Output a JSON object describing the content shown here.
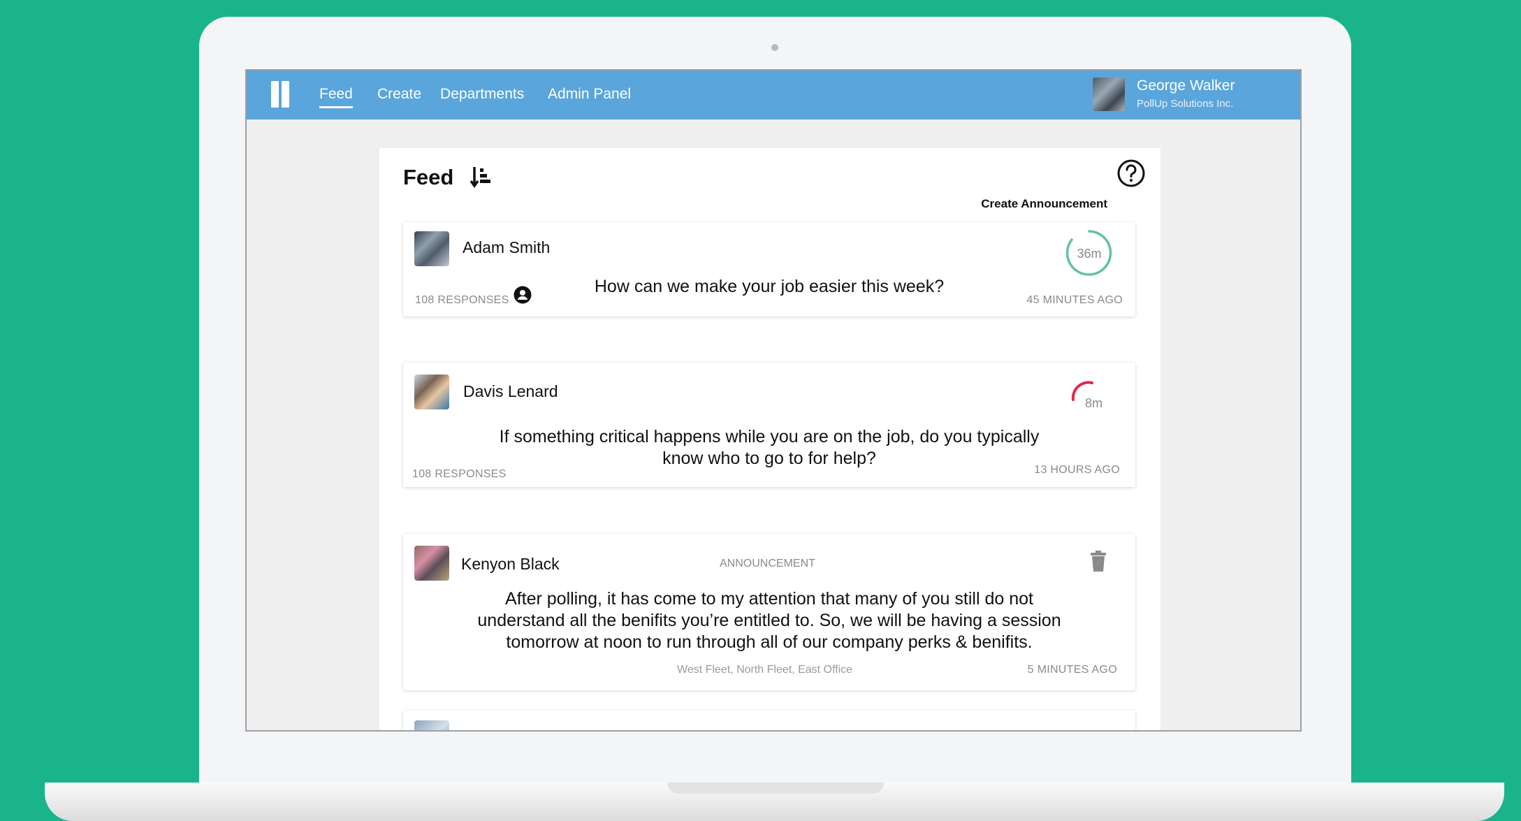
{
  "nav": {
    "items": [
      {
        "label": "Feed"
      },
      {
        "label": "Create"
      },
      {
        "label": "Departments"
      },
      {
        "label": "Admin Panel"
      }
    ],
    "user_name": "George Walker",
    "company": "PollUp Solutions Inc."
  },
  "feed": {
    "title": "Feed",
    "create_announcement": "Create Announcement"
  },
  "posts": [
    {
      "author": "Adam Smith",
      "question": "How can we make your job easier this week?",
      "responses": "108 RESPONSES",
      "time_ago": "45 MINUTES AGO",
      "timer_label": "36m",
      "timer_color": "#5ec3a3"
    },
    {
      "author": "Davis Lenard",
      "question_line1": "If something critical happens while you are on the job, do you typically",
      "question_line2": "know who to go to for help?",
      "responses": "108 RESPONSES",
      "time_ago": "13 HOURS AGO",
      "timer_label": "8m",
      "timer_color": "#e2284a"
    },
    {
      "author": "Kenyon Black",
      "tag": "ANNOUNCEMENT",
      "text_line1": "After polling, it has come to my attention that many of you still do not",
      "text_line2": "understand all the benifits you’re entitled to. So, we will be having a session",
      "text_line3": "tomorrow at noon to run through all of our company perks & benifits.",
      "departments": "West Fleet, North Fleet, East Office",
      "time_ago": "5 MINUTES AGO"
    }
  ],
  "colors": {
    "background": "#19b48c",
    "navbar": "#5aa5dc"
  }
}
